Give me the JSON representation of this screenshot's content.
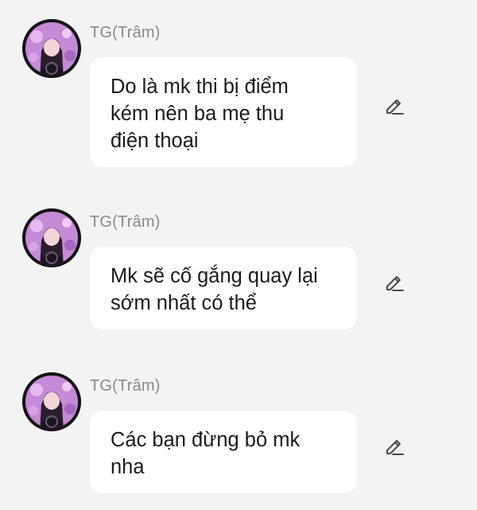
{
  "messages": [
    {
      "sender": "TG(Trâm)",
      "lines": [
        "Do là mk thi bị điểm",
        "kém nên ba mẹ thu",
        "điện thoại"
      ]
    },
    {
      "sender": "TG(Trâm)",
      "lines": [
        "Mk sẽ cố gắng quay lại",
        "sớm nhất có thể"
      ]
    },
    {
      "sender": "TG(Trâm)",
      "lines": [
        "Các bạn đừng bỏ mk",
        "nha"
      ]
    }
  ],
  "icons": {
    "edit": "pencil-icon",
    "avatar": "anime-girl-avatar"
  },
  "colors": {
    "background": "#f3f3f4",
    "bubble": "#ffffff",
    "sender_name": "#8a8a8d",
    "text": "#1b1b1b",
    "icon": "#4a4a4d"
  }
}
